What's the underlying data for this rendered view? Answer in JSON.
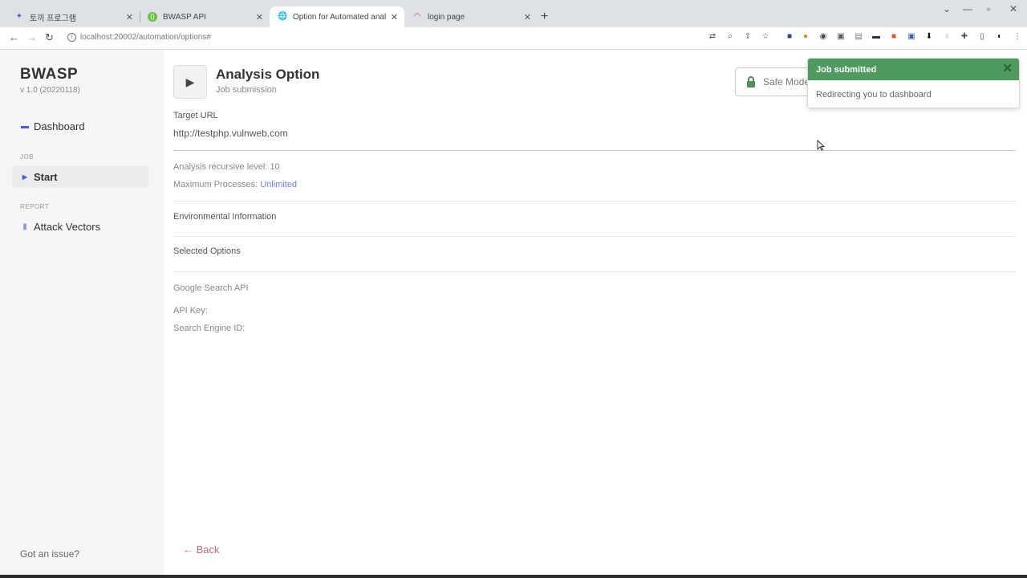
{
  "browser": {
    "tabs": [
      {
        "label": "토끼 프로그램",
        "icon": "puzzle-icon",
        "color": "#5a5ae0"
      },
      {
        "label": "BWASP API",
        "icon": "api-icon",
        "color": "#6fbf3f"
      },
      {
        "label": "Option for Automated analysis",
        "icon": "globe-icon",
        "color": "#444444"
      },
      {
        "label": "login page",
        "icon": "page-icon",
        "color": "#cc4444"
      }
    ],
    "url": "localhost:20002/automation/options#"
  },
  "sidebar": {
    "brand": "BWASP",
    "version": "v 1.0 (20220118)",
    "dashboard_label": "Dashboard",
    "job_section": "JOB",
    "start_label": "Start",
    "report_section": "REPORT",
    "attack_vectors_label": "Attack Vectors",
    "issue_label": "Got an issue?"
  },
  "main": {
    "title": "Analysis Option",
    "subtitle": "Job submission",
    "safe_mode_label": "Safe Mode",
    "target_url_label": "Target URL",
    "target_url_value": "http://testphp.vulnweb.com",
    "recursive_label": "Analysis recursive level:",
    "recursive_value": "10",
    "max_processes_label": "Maximum Processes:",
    "max_processes_value": "Unlimited",
    "env_info_label": "Environmental Information",
    "selected_options_label": "Selected Options",
    "google_api_label": "Google Search API",
    "api_key_label": "API Key:",
    "search_engine_label": "Search Engine ID:",
    "back_label": "← Back"
  },
  "toast": {
    "title": "Job submitted",
    "message": "Redirecting you to dashboard",
    "accent": "#4f9a5e"
  }
}
